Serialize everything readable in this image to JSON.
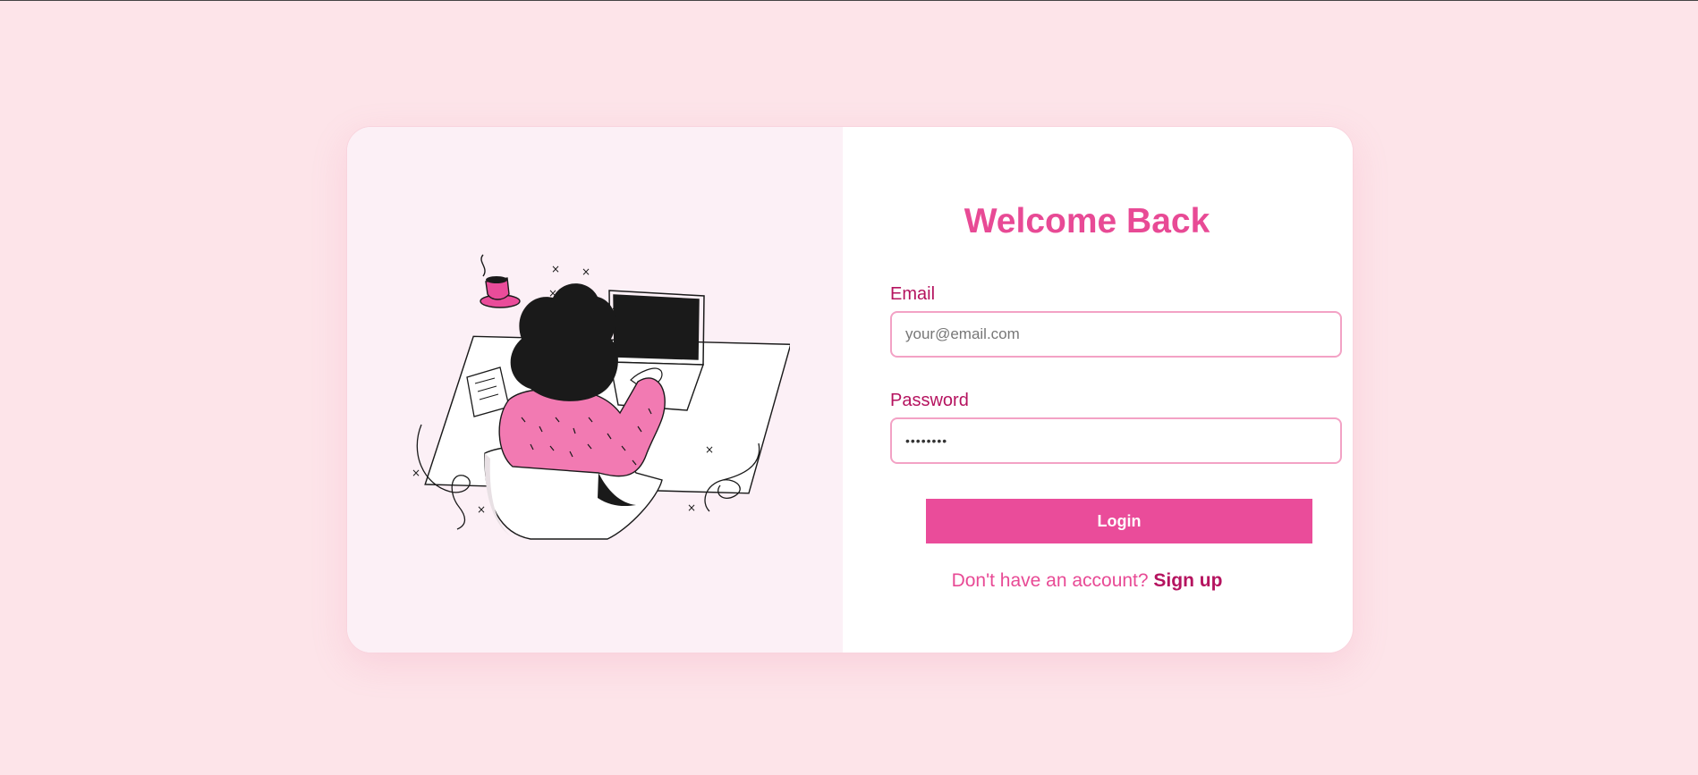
{
  "login": {
    "title": "Welcome Back",
    "email_label": "Email",
    "email_placeholder": "your@email.com",
    "password_label": "Password",
    "password_value": "••••••••",
    "login_button": "Login",
    "signup_prompt": "Don't have an account?",
    "signup_link": "Sign up"
  },
  "colors": {
    "accent": "#ea4c9a",
    "label": "#b5135f",
    "page_background": "#fde4e9",
    "illustration_panel": "#fcf0f6"
  },
  "illustration": {
    "name": "woman-working-at-laptop-illustration"
  }
}
